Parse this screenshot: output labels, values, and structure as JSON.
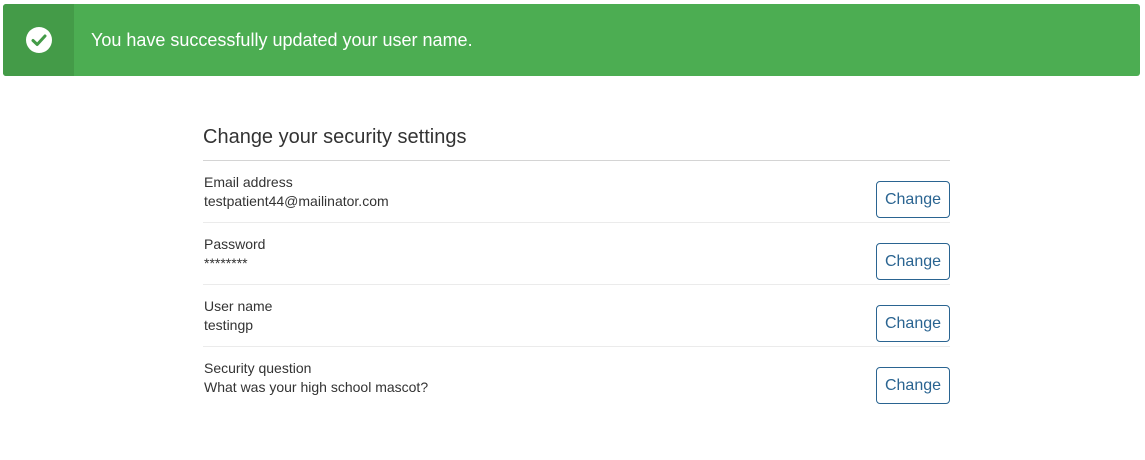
{
  "alert": {
    "icon": "check-circle-icon",
    "message": "You have successfully updated your user name.",
    "color": "#4cad52"
  },
  "security": {
    "title": "Change your security settings",
    "rows": [
      {
        "label": "Email address",
        "value": "testpatient44@mailinator.com",
        "button": "Change"
      },
      {
        "label": "Password",
        "value": "********",
        "button": "Change"
      },
      {
        "label": "User name",
        "value": "testingp",
        "button": "Change"
      },
      {
        "label": "Security question",
        "value": "What was your high school mascot?",
        "button": "Change"
      }
    ]
  }
}
